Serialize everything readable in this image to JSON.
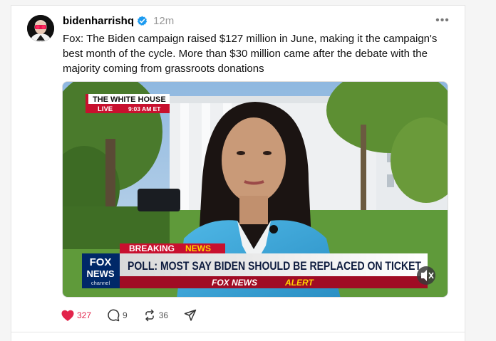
{
  "post": {
    "username": "bidenharrishq",
    "time": "12m",
    "more_label": "•••",
    "text": "Fox: The Biden campaign raised $127 million in June, making it the campaign's best month of the cycle. More than $30 million came after the debate with the majority coming from grassroots donations"
  },
  "media": {
    "location_tag": "THE WHITE HOUSE",
    "live_label": "LIVE",
    "live_time": "9:03 AM ET",
    "breaking_label_1": "BREAKING",
    "breaking_label_2": "NEWS",
    "headline": "POLL: MOST SAY BIDEN SHOULD BE REPLACED ON TICKET",
    "alert_label_1": "FOX NEWS",
    "alert_label_2": "ALERT",
    "logo_line_1": "FOX",
    "logo_line_2": "NEWS",
    "logo_line_3": "channel"
  },
  "actions": {
    "likes": "327",
    "replies": "9",
    "reposts": "36"
  },
  "colors": {
    "like": "#e2244b",
    "verified": "#1d9bf0",
    "fox_red": "#c8102e",
    "fox_blue": "#002868"
  }
}
